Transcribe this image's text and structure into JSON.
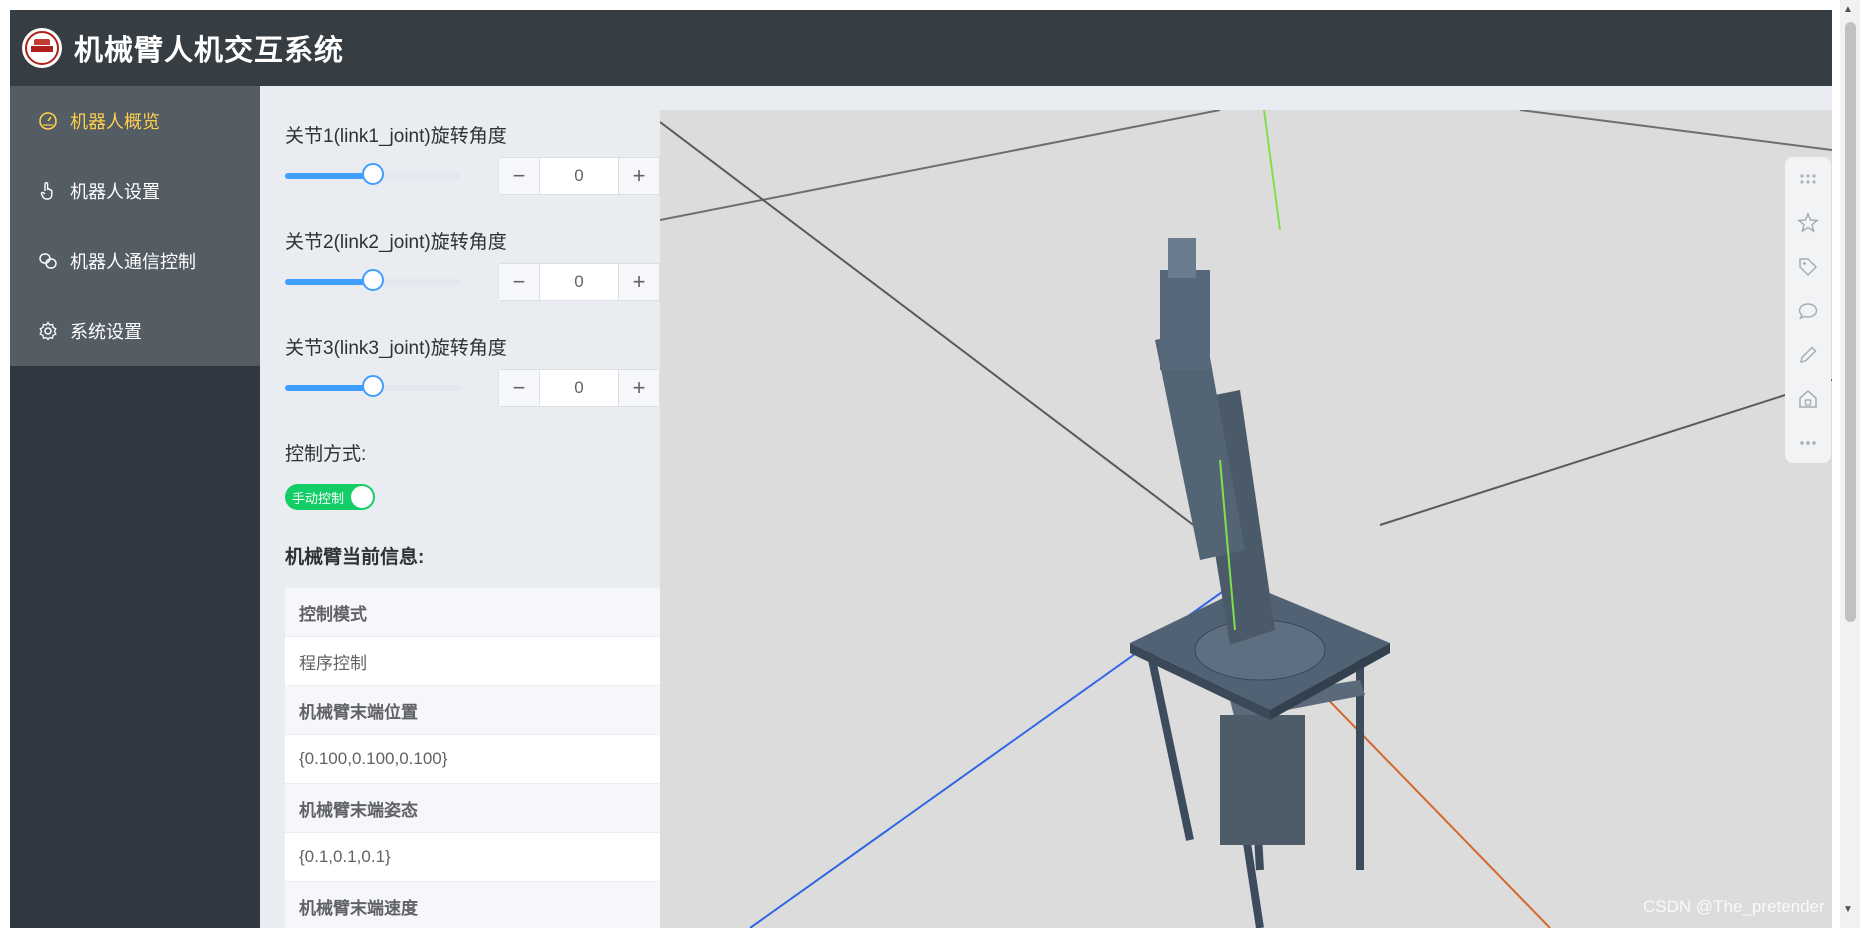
{
  "header": {
    "title": "机械臂人机交互系统"
  },
  "sidebar": {
    "items": [
      {
        "label": "机器人概览",
        "icon": "gauge-icon",
        "active": true
      },
      {
        "label": "机器人设置",
        "icon": "hand-pointer-icon",
        "active": false
      },
      {
        "label": "机器人通信控制",
        "icon": "link-icon",
        "active": false
      },
      {
        "label": "系统设置",
        "icon": "gear-icon",
        "active": false
      }
    ]
  },
  "joints": [
    {
      "label": "关节1(link1_joint)旋转角度",
      "value": "0",
      "slider_fraction": 0.5
    },
    {
      "label": "关节2(link2_joint)旋转角度",
      "value": "0",
      "slider_fraction": 0.5
    },
    {
      "label": "关节3(link3_joint)旋转角度",
      "value": "0",
      "slider_fraction": 0.5
    }
  ],
  "control": {
    "label": "控制方式:",
    "switch_text": "手动控制",
    "switch_on": true
  },
  "info": {
    "title": "机械臂当前信息:",
    "rows": [
      {
        "key": "控制模式",
        "value": "程序控制"
      },
      {
        "key": "机械臂末端位置",
        "value": "{0.100,0.100,0.100}"
      },
      {
        "key": "机械臂末端姿态",
        "value": "{0.1,0.1,0.1}"
      },
      {
        "key": "机械臂末端速度",
        "value": ""
      }
    ]
  },
  "toolbar": {
    "icons": [
      "grid-dots-icon",
      "star-icon",
      "tag-icon",
      "comment-icon",
      "pen-icon",
      "home-icon",
      "more-icon"
    ]
  },
  "watermark": "CSDN @The_pretender",
  "colors": {
    "accent": "#409eff",
    "menu_active": "#ffd04b",
    "switch_on": "#13ce66",
    "header_bg": "#363e43"
  }
}
